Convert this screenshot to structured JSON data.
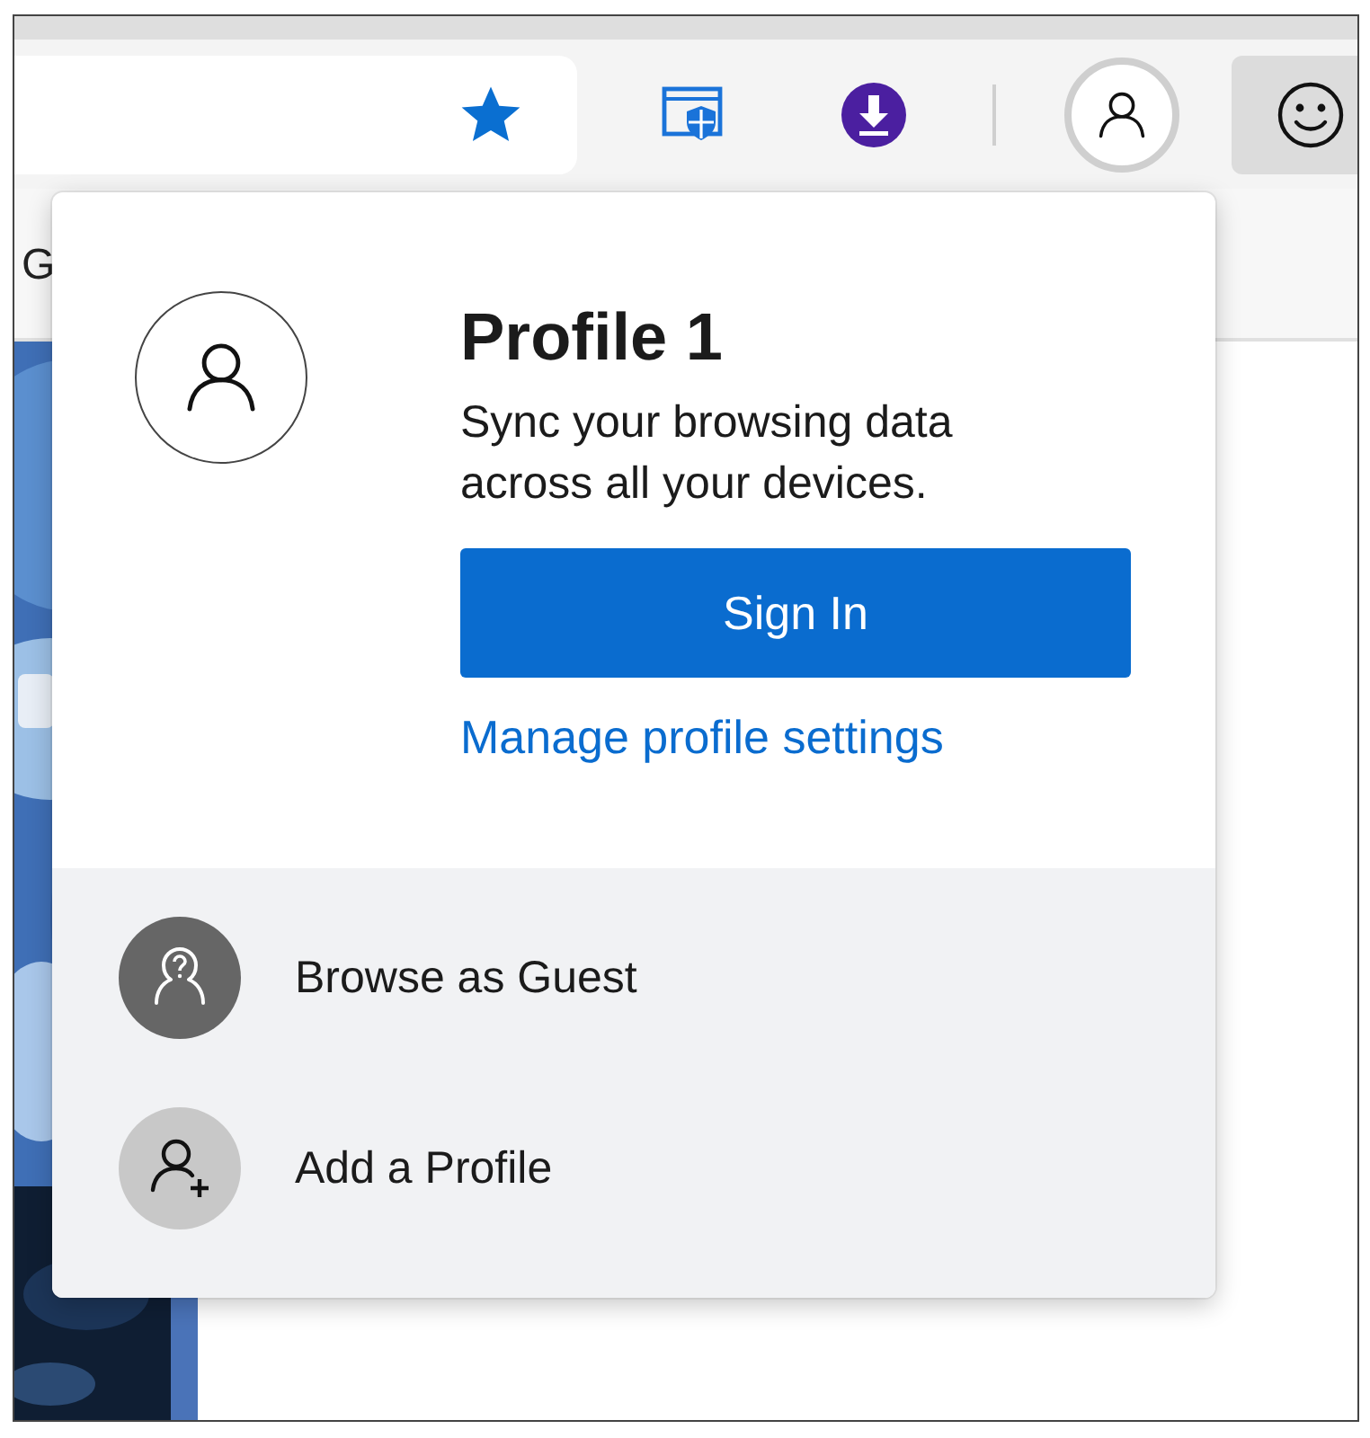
{
  "toolbar": {
    "buttons": [
      {
        "kind": "extension",
        "active": false
      },
      {
        "kind": "download",
        "active": false
      },
      {
        "kind": "separator",
        "active": false
      },
      {
        "kind": "profile",
        "active": true
      },
      {
        "kind": "feedback",
        "active": false
      }
    ]
  },
  "bookmarks_bar": {
    "items": [
      {
        "label": "G"
      }
    ]
  },
  "flyout": {
    "name": "Profile 1",
    "message": "Sync your browsing data across all your devices.",
    "sign_in": "Sign In",
    "manage_link": "Manage profile settings",
    "items": [
      {
        "kind": "guest",
        "label": "Browse as Guest"
      },
      {
        "kind": "add",
        "label": "Add a Profile"
      }
    ]
  }
}
